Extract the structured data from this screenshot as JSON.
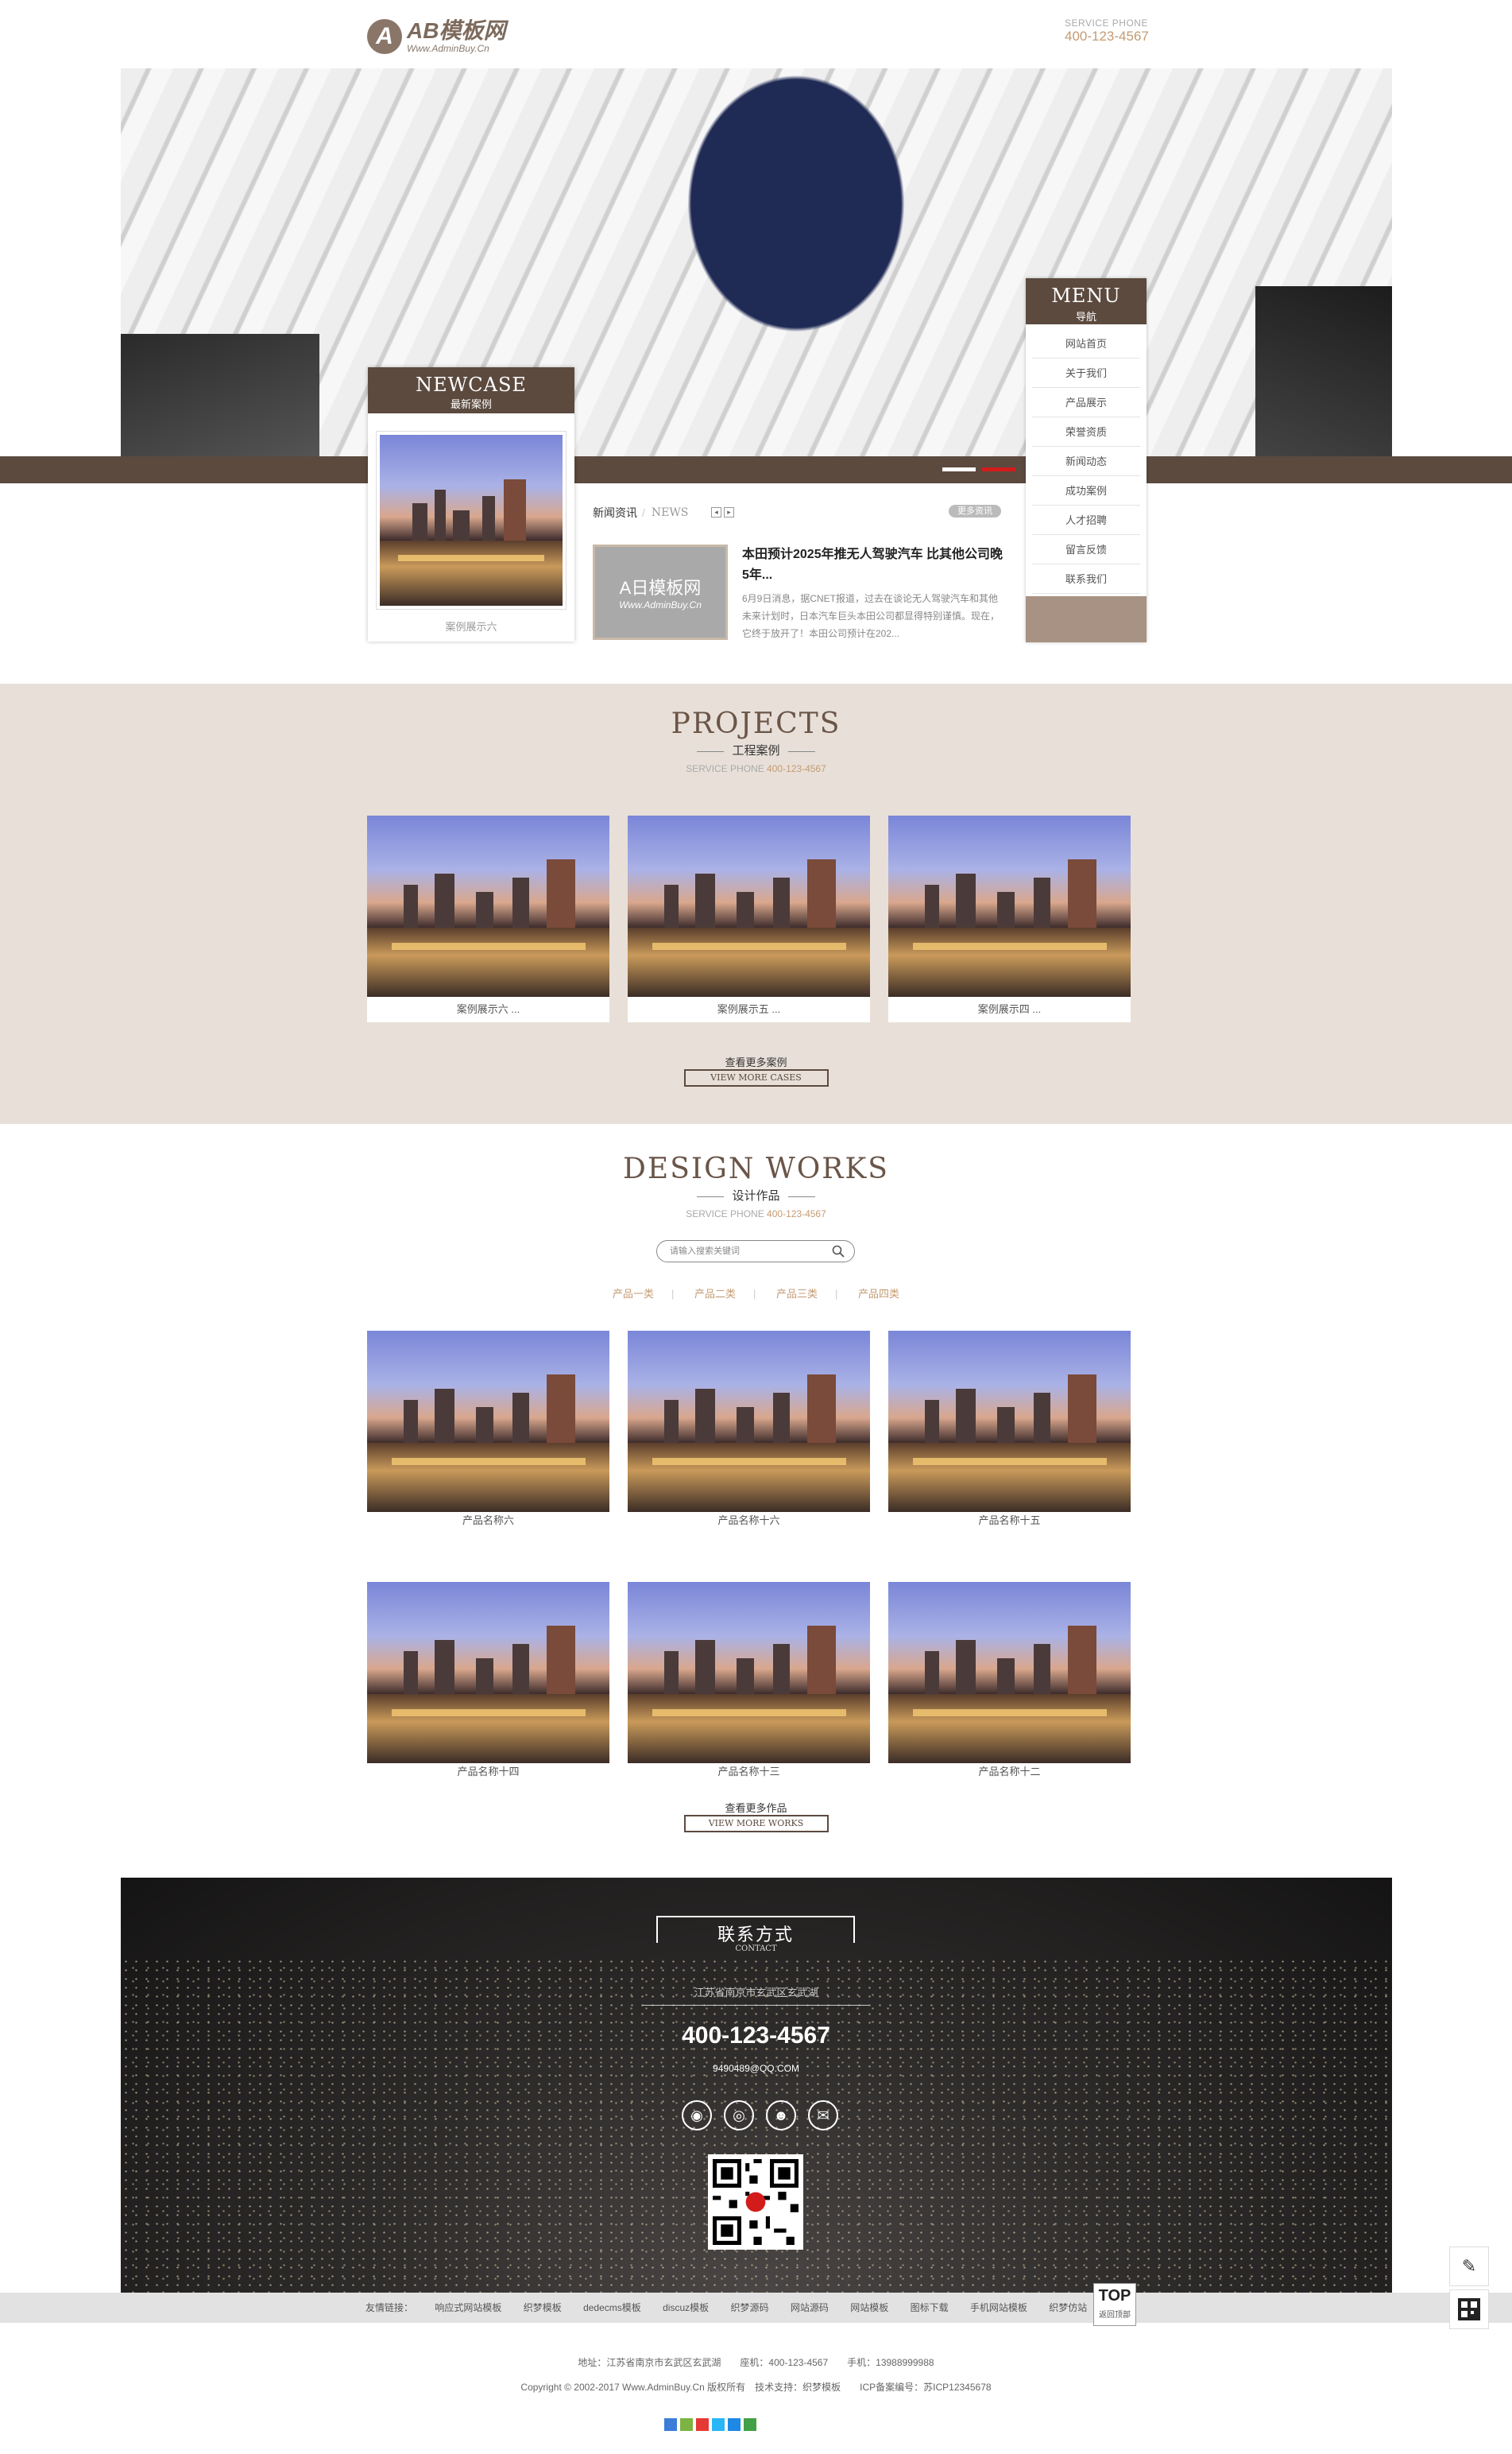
{
  "header": {
    "logo_mark": "A",
    "logo_name": "AB模板网",
    "logo_url": "Www.AdminBuy.Cn",
    "service_label": "SERVICE PHONE",
    "service_phone": "400-123-4567"
  },
  "menu": {
    "title_en": "MENU",
    "title_cn": "导航",
    "items": [
      "网站首页",
      "关于我们",
      "产品展示",
      "荣誉资质",
      "新闻动态",
      "成功案例",
      "人才招聘",
      "留言反馈",
      "联系我们"
    ]
  },
  "hero": {
    "slides": 2,
    "active_slide": 2
  },
  "newcase": {
    "title_en": "NEWCASE",
    "title_cn": "最新案例",
    "caption": "案例展示六"
  },
  "news": {
    "tab_cn": "新闻资讯",
    "tab_en": "NEWS",
    "prev": "◂",
    "next": "▸",
    "more": "更多资讯",
    "thumb_a": "A日模板网",
    "thumb_b": "Www.AdminBuy.Cn",
    "title": "本田预计2025年推无人驾驶汽车 比其他公司晚5年...",
    "desc": "6月9日消息，据CNET报道，过去在谈论无人驾驶汽车和其他未来计划时，日本汽车巨头本田公司都显得特别谨慎。现在，它终于放开了！本田公司预计在202..."
  },
  "projects": {
    "title_en": "PROJECTS",
    "title_cn": "工程案例",
    "service_label": "SERVICE PHONE",
    "service_phone": "400-123-4567",
    "items": [
      "案例展示六 ...",
      "案例展示五 ...",
      "案例展示四 ..."
    ],
    "more_cn": "查看更多案例",
    "more_en": "VIEW MORE CASES"
  },
  "design": {
    "title_en": "DESIGN WORKS",
    "title_cn": "设计作品",
    "service_label": "SERVICE PHONE",
    "service_phone": "400-123-4567",
    "search_placeholder": "请输入搜索关键词",
    "categories": [
      "产品一类",
      "产品二类",
      "产品三类",
      "产品四类"
    ],
    "items": [
      "产品名称六",
      "产品名称十六",
      "产品名称十五",
      "产品名称十四",
      "产品名称十三",
      "产品名称十二"
    ],
    "more_cn": "查看更多作品",
    "more_en": "VIEW MORE WORKS"
  },
  "contact": {
    "title": "联系方式",
    "subtitle": "CONTACT",
    "address": "江苏省南京市玄武区玄武湖",
    "phone": "400-123-4567",
    "email": "9490489@QQ.COM",
    "socials": [
      "weibo-icon",
      "tencent-weibo-icon",
      "qq-icon",
      "wechat-icon"
    ]
  },
  "links": {
    "label": "友情链接：",
    "items": [
      "响应式网站模板",
      "织梦模板",
      "dedecms模板",
      "discuz模板",
      "织梦源码",
      "网站源码",
      "网站模板",
      "图标下载",
      "手机网站模板",
      "织梦仿站"
    ]
  },
  "top_button": {
    "label": "TOP",
    "sub": "返回顶部"
  },
  "footer": {
    "line1": "地址：江苏省南京市玄武区玄武湖　　座机：400-123-4567　　手机：13988999988",
    "line2": "Copyright © 2002-2017 Www.AdminBuy.Cn 版权所有　技术支持：织梦模板　　ICP备案编号：苏ICP12345678"
  },
  "colors": {
    "brand": "#5c4a3f",
    "accent": "#c49b73",
    "section_bg": "#e8e0d8",
    "slide_active": "#d21c1c"
  }
}
